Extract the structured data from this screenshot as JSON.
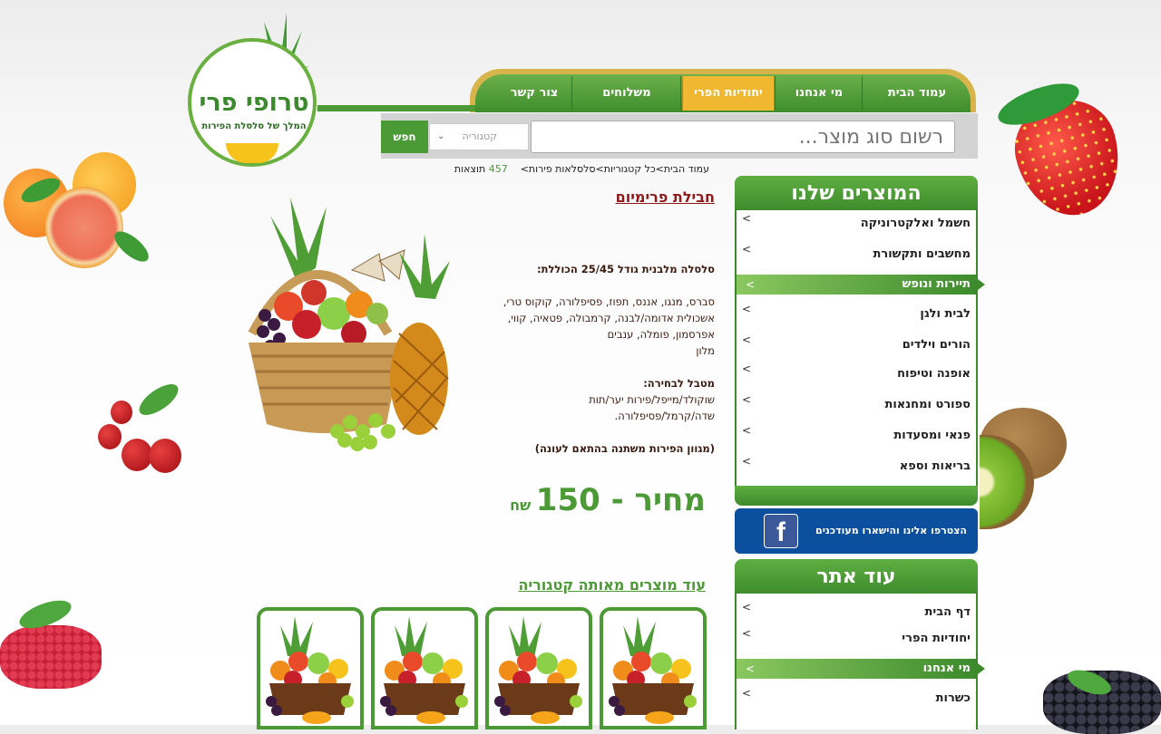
{
  "logo": {
    "name": "טרופי פרי",
    "tagline": "המלך של סלסלת הפירות"
  },
  "nav": {
    "items": [
      "עמוד הבית",
      "מי אנחנו",
      "יחודיות הפרי",
      "משלוחים",
      "צור קשר"
    ],
    "active_index": 2
  },
  "search": {
    "button": "חפש",
    "category_label": "קטגוריה",
    "placeholder": "רשום סוג מוצר..."
  },
  "breadcrumb": {
    "path": "עמוד הבית>כל קטגוריות>סלסלאות פירות>",
    "count": "457",
    "count_label": "תוצאות"
  },
  "product": {
    "title": "חבילת פרימיום",
    "desc_heading": "סלסלה מלבנית גודל 25/45 הכוללת:",
    "desc_fruits": [
      "סברס, מנגו, אננס, תפוז, פסיפלורה, קוקוס טרי,",
      "אשכולית אדומה/לבנה, קרמבולה, פטאיה, קווי,",
      "אפרסמון, פומלה, ענבים",
      "מלון"
    ],
    "dip_heading": "מטבל לבחירה:",
    "dip_options": [
      "שוקולד/מייפל/פירות יער/תות",
      "שדה/קרמל/פסיפלורה."
    ],
    "note": "(מגוון הפירות משתנה בהתאם לעונה)",
    "price_label": "מחיר - 150",
    "currency": "שח"
  },
  "more": {
    "title": "עוד מוצרים מאותה קטגוריה"
  },
  "sidebar": {
    "products_title": "המוצרים שלנו",
    "categories": [
      "חשמל ואלקטרוניקה",
      "מחשבים ותקשורת",
      "תיירות ונופש",
      "לבית ולגן",
      "הורים וילדים",
      "אופנה וטיפוח",
      "ספורט ומחנאות",
      "פנאי ומסעדות",
      "בריאות וספא"
    ],
    "categories_active": 2,
    "facebook_text": "הצטרפו אלינו והישארו מעודכנים",
    "site_title": "עוד אתר",
    "site_links": [
      "דף הבית",
      "יחודיות הפרי",
      "מי אנחנו",
      "כשרות"
    ],
    "site_active": 2,
    "arrow": ">"
  },
  "colors": {
    "green": "#4b9a35",
    "gold": "#f0b731",
    "title_red": "#8e1a1a",
    "facebook": "#0c4f9e"
  }
}
